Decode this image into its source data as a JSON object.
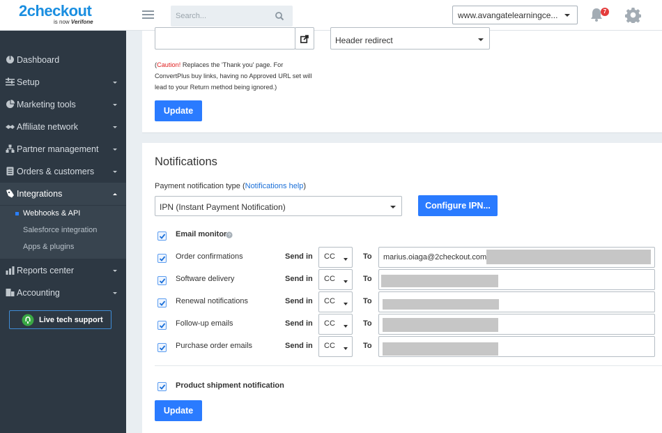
{
  "header": {
    "logo_main": "2checkout",
    "logo_sub_prefix": "is now",
    "logo_sub_brand": "Verifone",
    "search_placeholder": "Search...",
    "account": "www.avangatelearningce...",
    "notification_count": "7"
  },
  "sidebar": {
    "items": [
      {
        "label": "Dashboard",
        "icon": "dashboard-icon"
      },
      {
        "label": "Setup",
        "icon": "setup-icon"
      },
      {
        "label": "Marketing tools",
        "icon": "marketing-icon"
      },
      {
        "label": "Affiliate network",
        "icon": "affiliate-icon"
      },
      {
        "label": "Partner management",
        "icon": "partner-icon"
      },
      {
        "label": "Orders & customers",
        "icon": "orders-icon"
      },
      {
        "label": "Integrations",
        "icon": "integrations-icon"
      },
      {
        "label": "Reports center",
        "icon": "reports-icon"
      },
      {
        "label": "Accounting",
        "icon": "accounting-icon"
      }
    ],
    "integrations_sub": [
      "Webhooks & API",
      "Salesforce integration",
      "Apps & plugins"
    ],
    "live_support": "Live tech support"
  },
  "top_panel": {
    "redirect_method": "Header redirect",
    "caution_word": "Caution!",
    "caution_text": " Replaces the 'Thank you' page. For ConvertPlus buy links, having no Approved URL set will lead to your Return method being ignored.)",
    "caution_open": "(",
    "update_label": "Update"
  },
  "notifications": {
    "title": "Notifications",
    "payment_label": "Payment notification type (",
    "payment_help": "Notifications help",
    "payment_close": ")",
    "payment_type": "IPN (Instant Payment Notification)",
    "configure_label": "Configure IPN...",
    "email_monitor": "Email monitor",
    "send_in": "Send in",
    "to": "To",
    "rows": [
      {
        "label": "Order confirmations",
        "mode": "CC",
        "email": "marius.oiaga@2checkout.com"
      },
      {
        "label": "Software delivery",
        "mode": "CC",
        "email": ""
      },
      {
        "label": "Renewal notifications",
        "mode": "CC",
        "email": ""
      },
      {
        "label": "Follow-up emails",
        "mode": "CC",
        "email": ""
      },
      {
        "label": "Purchase order emails",
        "mode": "CC",
        "email": ""
      }
    ],
    "shipment_label": "Product shipment notification",
    "update_label": "Update"
  },
  "colors": {
    "accent": "#2a7bff",
    "sidebar_bg": "#2d3843",
    "caution_red": "#e02020",
    "badge_red": "#e43c3c"
  }
}
